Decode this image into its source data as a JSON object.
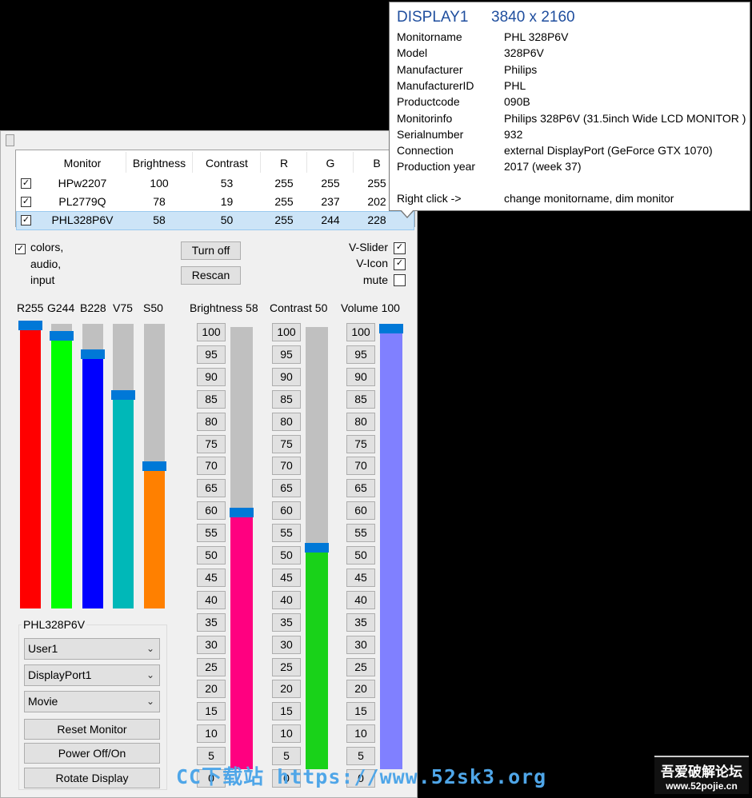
{
  "table": {
    "headers": [
      "Monitor",
      "Brightness",
      "Contrast",
      "R",
      "G",
      "B"
    ],
    "rows": [
      {
        "checked": "✓",
        "monitor": "HPw2207",
        "brightness": "100",
        "contrast": "53",
        "r": "255",
        "g": "255",
        "b": "255"
      },
      {
        "checked": "✓",
        "monitor": "PL2779Q",
        "brightness": "78",
        "contrast": "19",
        "r": "255",
        "g": "237",
        "b": "202"
      },
      {
        "checked": "✓",
        "monitor": "PHL328P6V",
        "brightness": "58",
        "contrast": "50",
        "r": "255",
        "g": "244",
        "b": "228",
        "selected": true
      }
    ]
  },
  "options": {
    "colors_check": "✓",
    "colors_label": "colors,",
    "audio_label": "audio,",
    "input_label": "input",
    "turn_off": "Turn off",
    "rescan": "Rescan",
    "vslider_label": "V-Slider",
    "vslider_check": "✓",
    "vicon_label": "V-Icon",
    "vicon_check": "✓",
    "mute_label": "mute",
    "mute_check": ""
  },
  "color_sliders": [
    {
      "label": "R255",
      "value": 255,
      "max": 255,
      "color": "#ff0000"
    },
    {
      "label": "G244",
      "value": 244,
      "max": 255,
      "color": "#00ff00"
    },
    {
      "label": "B228",
      "value": 228,
      "max": 255,
      "color": "#0000ff"
    },
    {
      "label": "V75",
      "value": 75,
      "max": 100,
      "color": "#00b8b8"
    },
    {
      "label": "S50",
      "value": 50,
      "max": 100,
      "color": "#ff8000"
    }
  ],
  "main_sliders": {
    "brightness": {
      "label": "Brightness 58",
      "value": 58,
      "color": "#ff0080"
    },
    "contrast": {
      "label": "Contrast 50",
      "value": 50,
      "color": "#19d219"
    },
    "volume": {
      "label": "Volume 100",
      "value": 100,
      "color": "#8080ff"
    }
  },
  "steps": [
    "100",
    "95",
    "90",
    "85",
    "80",
    "75",
    "70",
    "65",
    "60",
    "55",
    "50",
    "45",
    "40",
    "35",
    "30",
    "25",
    "20",
    "15",
    "10",
    "5",
    "0"
  ],
  "group": {
    "title": "PHL328P6V",
    "preset": "User1",
    "input": "DisplayPort1",
    "mode": "Movie",
    "reset": "Reset Monitor",
    "power": "Power Off/On",
    "rotate": "Rotate Display",
    "chevron": "⌄"
  },
  "tooltip": {
    "display": "DISPLAY1",
    "resolution": "3840 x 2160",
    "title_color": "#1f4e9e",
    "rows": [
      {
        "k": "Monitorname",
        "v": "PHL 328P6V"
      },
      {
        "k": "Model",
        "v": "328P6V"
      },
      {
        "k": "Manufacturer",
        "v": "Philips"
      },
      {
        "k": "ManufacturerID",
        "v": "PHL"
      },
      {
        "k": "Productcode",
        "v": "090B"
      },
      {
        "k": "Monitorinfo",
        "v": "Philips 328P6V (31.5inch Wide LCD MONITOR )"
      },
      {
        "k": "Serialnumber",
        "v": "932"
      },
      {
        "k": "Connection",
        "v": "external DisplayPort (GeForce GTX 1070)"
      },
      {
        "k": "Production year",
        "v": "2017 (week 37)"
      }
    ],
    "right_click_k": "Right click  ->",
    "right_click_v": "change monitorname, dim monitor"
  },
  "watermark": "CC下载站 https://www.52sk3.org",
  "logo": {
    "line1": "吾爱破解论坛",
    "line2": "www.52pojie.cn"
  }
}
